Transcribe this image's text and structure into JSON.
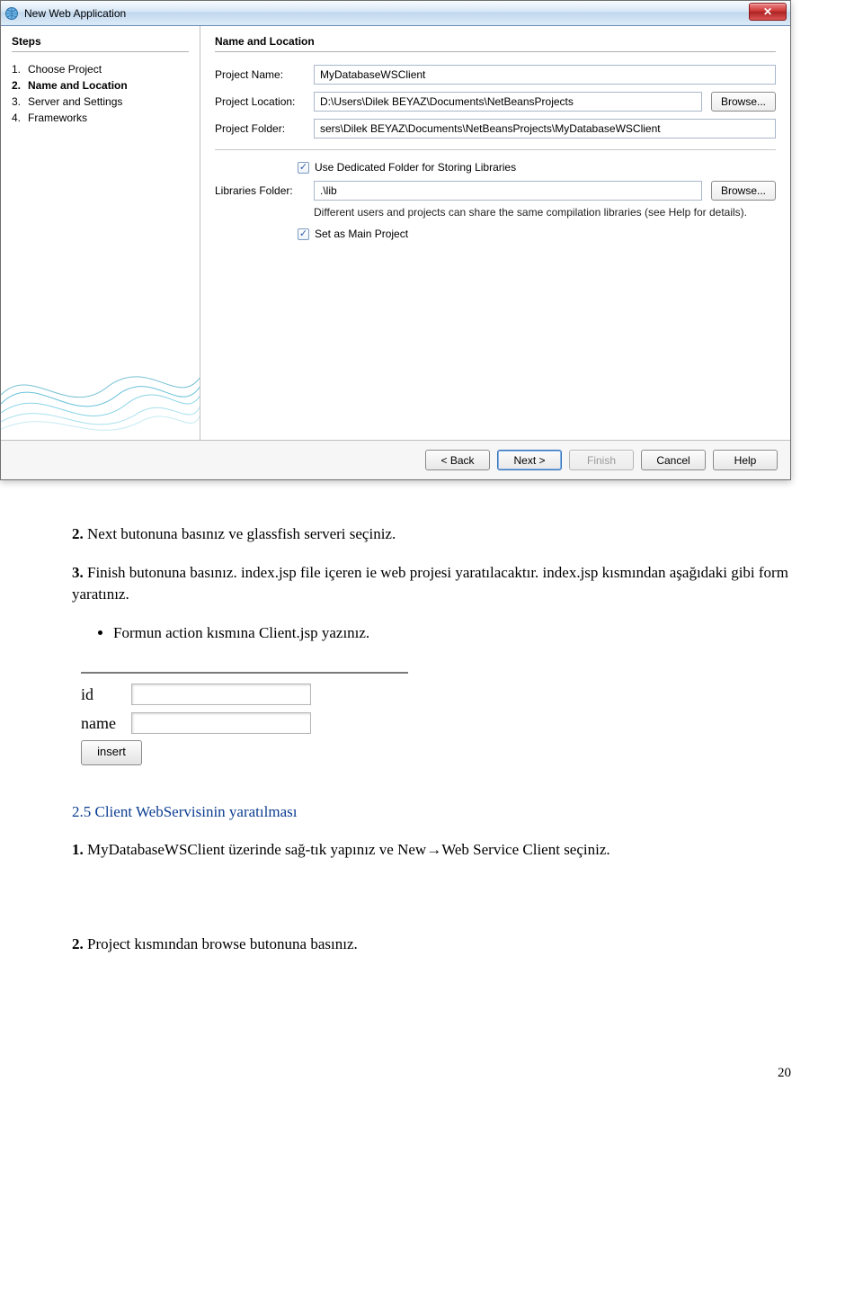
{
  "dialog": {
    "title": "New Web Application",
    "steps_title": "Steps",
    "steps": [
      {
        "num": "1.",
        "label": "Choose Project"
      },
      {
        "num": "2.",
        "label": "Name and Location"
      },
      {
        "num": "3.",
        "label": "Server and Settings"
      },
      {
        "num": "4.",
        "label": "Frameworks"
      }
    ],
    "content_title": "Name and Location",
    "labels": {
      "project_name": "Project Name:",
      "project_location": "Project Location:",
      "project_folder": "Project Folder:",
      "libraries_folder": "Libraries Folder:"
    },
    "values": {
      "project_name": "MyDatabaseWSClient",
      "project_location": "D:\\Users\\Dilek BEYAZ\\Documents\\NetBeansProjects",
      "project_folder": "sers\\Dilek BEYAZ\\Documents\\NetBeansProjects\\MyDatabaseWSClient",
      "libraries_folder": ".\\lib"
    },
    "browse_label": "Browse...",
    "chk_dedicated": "Use Dedicated Folder for Storing Libraries",
    "helper": "Different users and projects can share the same compilation libraries (see Help for details).",
    "chk_main": "Set as Main Project",
    "buttons": {
      "back": "< Back",
      "next": "Next >",
      "finish": "Finish",
      "cancel": "Cancel",
      "help": "Help"
    }
  },
  "doc": {
    "p1_prefix": "2.",
    "p1": "Next butonuna basınız ve glassfish serveri seçiniz.",
    "p2_prefix": "3.",
    "p2": "Finish butonuna basınız.  index.jsp file içeren ie web projesi yaratılacaktır. index.jsp kısmından aşağıdaki gibi form yaratınız.",
    "bullet1": "Formun action kısmına Client.jsp yazınız.",
    "heading25": "2.5 Client WebServisinin yaratılması",
    "step1_prefix": "1.",
    "step1": "MyDatabaseWSClient üzerinde sağ-tık yapınız ve New→Web Service Client seçiniz.",
    "step2_prefix": "2.",
    "step2": "Project kısmından browse butonuna basınız.",
    "page_number": "20"
  },
  "miniform": {
    "id_label": "id",
    "name_label": "name",
    "insert_label": "insert"
  }
}
